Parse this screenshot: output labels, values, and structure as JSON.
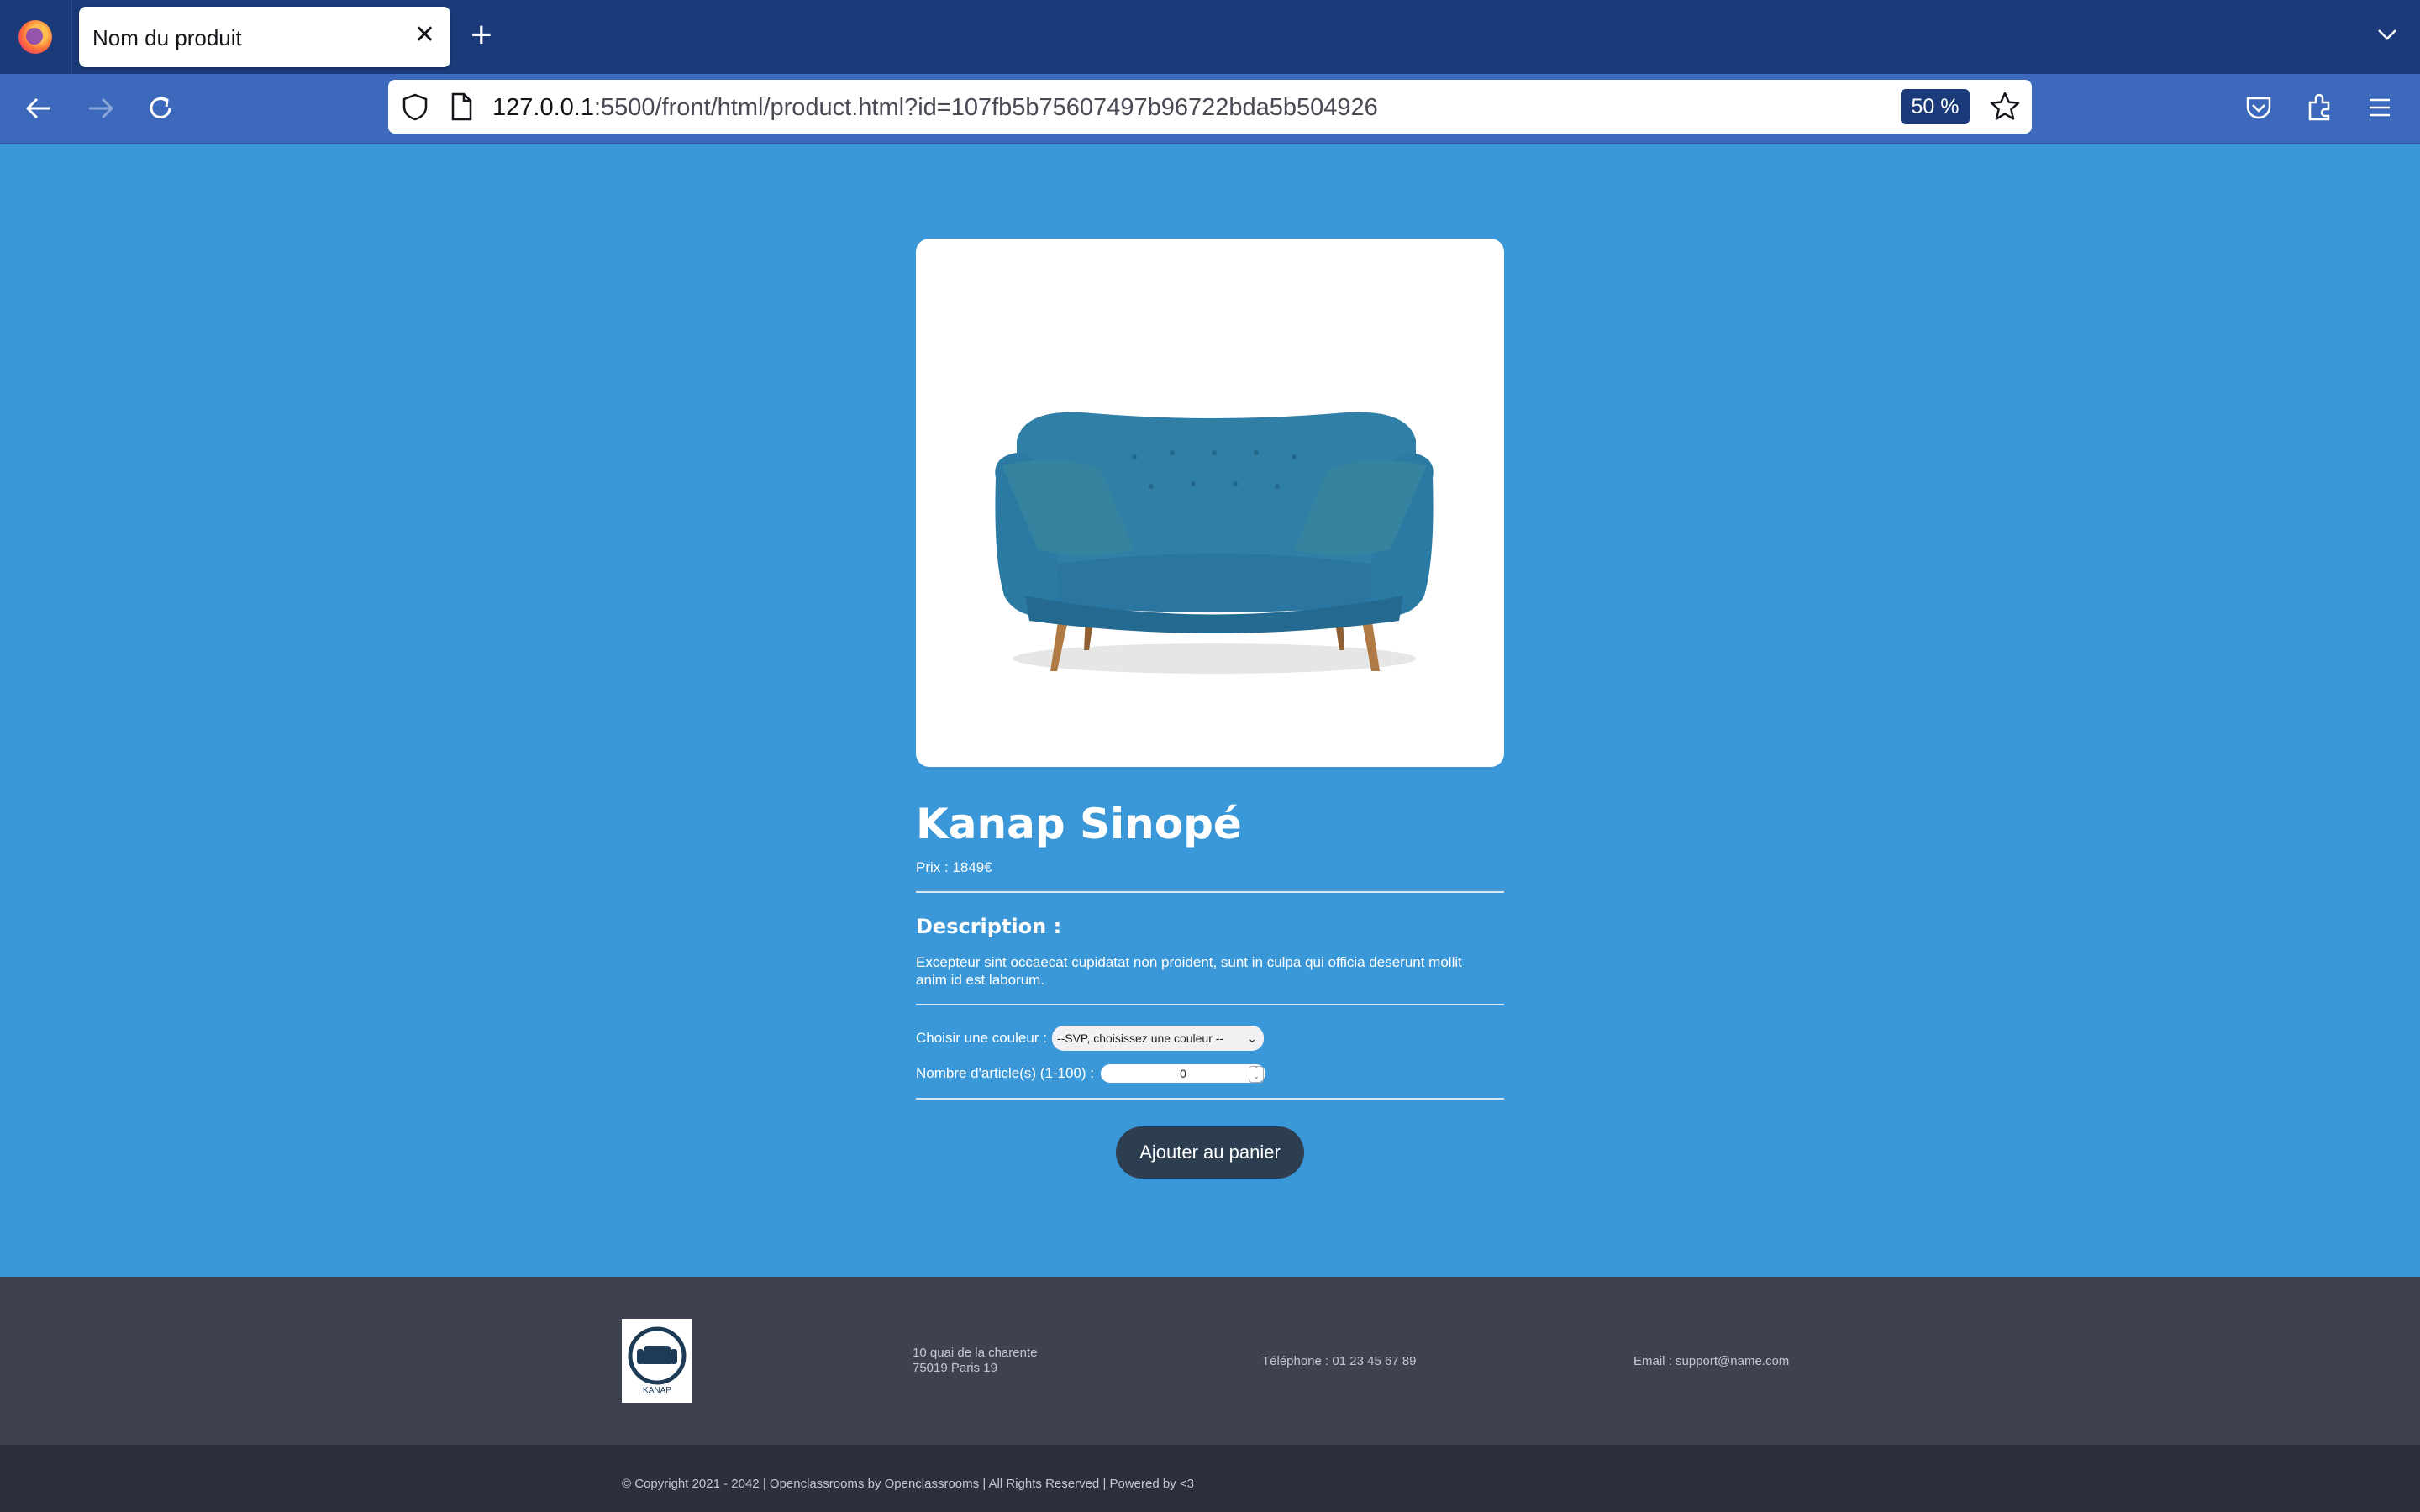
{
  "browser": {
    "tab_title": "Nom du produit",
    "url_host": "127.0.0.1",
    "url_path": ":5500/front/html/product.html?id=107fb5b75607497b96722bda5b504926",
    "zoom": "50 %"
  },
  "product": {
    "title": "Kanap Sinopé",
    "price": "Prix : 1849€",
    "description_heading": "Description :",
    "description": "Excepteur sint occaecat cupidatat non proident, sunt in culpa qui officia deserunt mollit anim id est laborum.",
    "color_label": "Choisir une couleur :",
    "color_select": "--SVP, choisissez une couleur --",
    "quantity_label": "Nombre d'article(s) (1-100) :",
    "quantity_value": "0",
    "add_button": "Ajouter au panier",
    "sofa_color": "#2f7fa6"
  },
  "footer": {
    "logo_text": "KANAP",
    "address_line1": "10 quai de la charente",
    "address_line2": "75019 Paris 19",
    "phone": "Téléphone : 01 23 45 67 89",
    "email": "Email : support@name.com",
    "copyright": "© Copyright 2021 - 2042 | Openclassrooms by Openclassrooms | All Rights Reserved | Powered by <3"
  }
}
